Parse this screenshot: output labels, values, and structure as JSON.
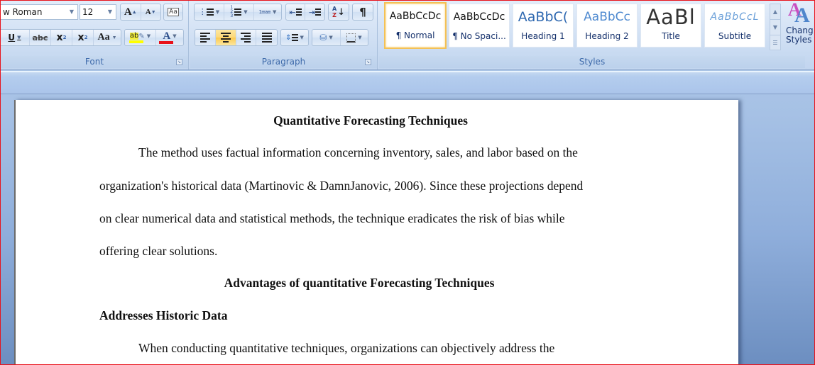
{
  "ribbon": {
    "font": {
      "label": "Font",
      "font_name": "w Roman",
      "font_size": "12",
      "buttons": {
        "grow_font": "A",
        "shrink_font": "A",
        "underline": "U",
        "strikethrough": "abc",
        "subscript": "x",
        "superscript": "x",
        "change_case": "Aa",
        "highlight": "ab",
        "font_color": "A"
      },
      "highlight_color": "#ffff00",
      "font_color_value": "#e8121a"
    },
    "paragraph": {
      "label": "Paragraph",
      "sort_label": "A Z",
      "pilcrow": "¶"
    },
    "styles": {
      "label": "Styles",
      "items": [
        {
          "sample": "AaBbCcDc",
          "name": "¶ Normal",
          "selected": true
        },
        {
          "sample": "AaBbCcDc",
          "name": "¶ No Spaci...",
          "selected": false
        },
        {
          "sample": "AaBbC(",
          "name": "Heading 1",
          "selected": false
        },
        {
          "sample": "AaBbCc",
          "name": "Heading 2",
          "selected": false
        },
        {
          "sample": "AaBl",
          "name": "Title",
          "selected": false
        },
        {
          "sample": "AaBbCcL",
          "name": "Subtitle",
          "selected": false
        }
      ],
      "change_styles_line1": "Chang",
      "change_styles_line2": "Styles"
    }
  },
  "document": {
    "title": "Quantitative Forecasting Techniques",
    "para1": [
      "The method uses factual information concerning inventory, sales, and labor based on the",
      "organization's historical  data (Martinovic & DamnJanovic, 2006). Since these projections depend",
      "on clear numerical  data and statistical methods, the technique eradicates the risk of bias while",
      "offering clear solutions."
    ],
    "heading2": "Advantages of quantitative Forecasting Techniques",
    "heading3": "Addresses Historic  Data",
    "para2": [
      "When conducting quantitative techniques, organizations  can objectively address the"
    ]
  }
}
